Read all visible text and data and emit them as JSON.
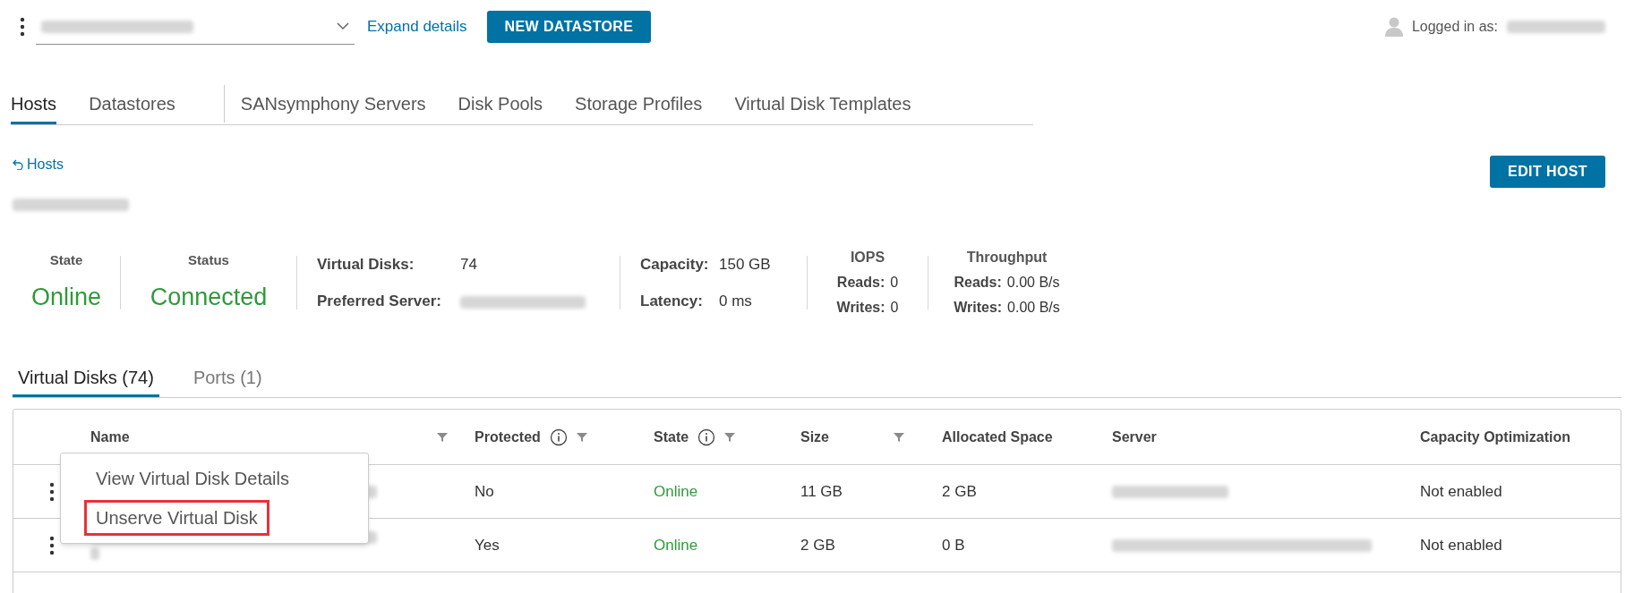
{
  "top_bar": {
    "expand_link": "Expand details",
    "new_button": "NEW DATASTORE",
    "logged_in_label": "Logged in as:"
  },
  "main_tab_groups": [
    {
      "tabs": [
        {
          "label": "Hosts",
          "selected": true
        },
        {
          "label": "Datastores",
          "selected": false
        }
      ]
    },
    {
      "tabs": [
        {
          "label": "SANsymphony Servers",
          "selected": false
        },
        {
          "label": "Disk Pools",
          "selected": false
        },
        {
          "label": "Storage Profiles",
          "selected": false
        },
        {
          "label": "Virtual Disk Templates",
          "selected": false
        }
      ]
    }
  ],
  "back_link": "Hosts",
  "edit_button": "EDIT HOST",
  "summary": {
    "state": {
      "label": "State",
      "value": "Online"
    },
    "status": {
      "label": "Status",
      "value": "Connected"
    },
    "details": [
      {
        "label": "Virtual Disks:",
        "value": "74"
      },
      {
        "label": "Preferred Server:"
      }
    ],
    "capacity": [
      {
        "label": "Capacity:",
        "value": "150 GB"
      },
      {
        "label": "Latency:",
        "value": "0 ms"
      }
    ],
    "iops": {
      "title": "IOPS",
      "rows": [
        {
          "label": "Reads:",
          "value": "0"
        },
        {
          "label": "Writes:",
          "value": "0"
        }
      ]
    },
    "throughput": {
      "title": "Throughput",
      "rows": [
        {
          "label": "Reads:",
          "value": "0.00 B/s"
        },
        {
          "label": "Writes:",
          "value": "0.00 B/s"
        }
      ]
    }
  },
  "sub_tabs": [
    {
      "label": "Virtual Disks (74)",
      "selected": true
    },
    {
      "label": "Ports (1)",
      "selected": false
    }
  ],
  "table": {
    "columns": [
      {
        "label": "Name",
        "filter": true,
        "info": false
      },
      {
        "label": "Protected",
        "filter": true,
        "info": true
      },
      {
        "label": "State",
        "filter": true,
        "info": true
      },
      {
        "label": "Size",
        "filter": true,
        "info": false
      },
      {
        "label": "Allocated Space",
        "filter": false,
        "info": false
      },
      {
        "label": "Server",
        "filter": false,
        "info": false
      },
      {
        "label": "Capacity Optimization",
        "filter": false,
        "info": false
      }
    ],
    "rows": [
      {
        "protected": "No",
        "state": "Online",
        "size": "11 GB",
        "allocated": "2 GB",
        "optimization": "Not enabled",
        "name_wraps": false,
        "menu_open": true
      },
      {
        "protected": "Yes",
        "state": "Online",
        "size": "2 GB",
        "allocated": "0 B",
        "optimization": "Not enabled",
        "name_wraps": true,
        "menu_open": false
      }
    ]
  },
  "context_menu": [
    {
      "label": "View Virtual Disk Details",
      "highlighted": false
    },
    {
      "label": "Unserve Virtual Disk",
      "highlighted": true
    }
  ]
}
